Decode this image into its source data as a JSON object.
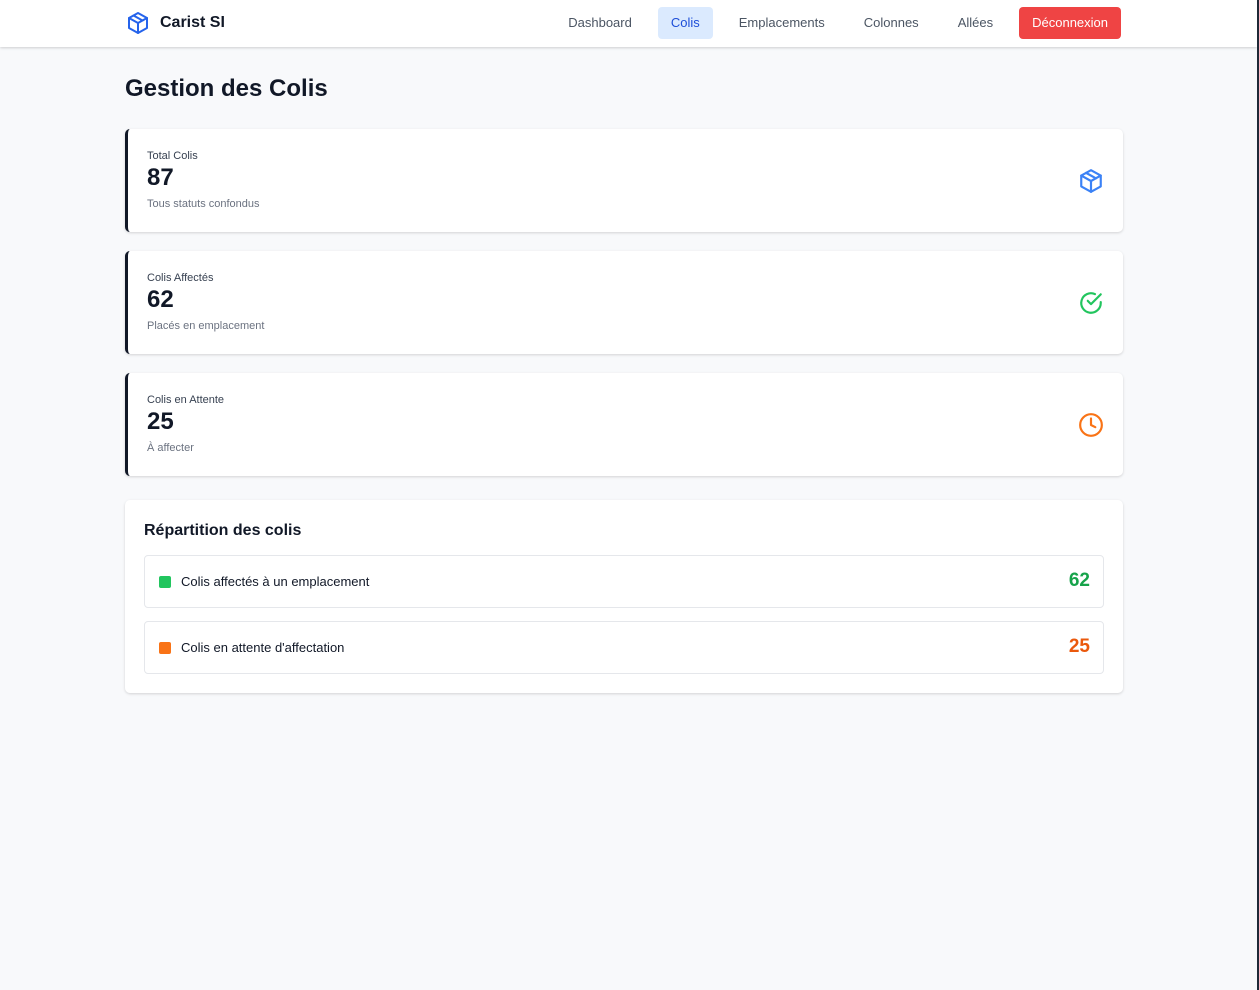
{
  "app": {
    "name": "Carist SI",
    "logo_icon": "package-icon"
  },
  "nav": {
    "items": [
      {
        "label": "Dashboard",
        "active": false
      },
      {
        "label": "Colis",
        "active": true
      },
      {
        "label": "Emplacements",
        "active": false
      },
      {
        "label": "Colonnes",
        "active": false
      },
      {
        "label": "Allées",
        "active": false
      }
    ],
    "logout_label": "Déconnexion"
  },
  "page": {
    "title": "Gestion des Colis"
  },
  "stats": [
    {
      "label": "Total Colis",
      "value": "87",
      "sub": "Tous statuts confondus",
      "icon": "package-icon",
      "color": "#3b82f6"
    },
    {
      "label": "Colis Affectés",
      "value": "62",
      "sub": "Placés en emplacement",
      "icon": "check-circle-icon",
      "color": "#22c55e"
    },
    {
      "label": "Colis en Attente",
      "value": "25",
      "sub": "À affecter",
      "icon": "clock-icon",
      "color": "#f97316"
    }
  ],
  "repartition": {
    "title": "Répartition des colis",
    "rows": [
      {
        "label": "Colis affectés à un emplacement",
        "value": "62",
        "color": "#22c55e",
        "value_color": "#16a34a"
      },
      {
        "label": "Colis en attente d'affectation",
        "value": "25",
        "color": "#f97316",
        "value_color": "#ea580c"
      }
    ]
  },
  "colors": {
    "primary": "#3b82f6",
    "danger": "#ef4444",
    "active_nav_bg": "#dbeafe"
  }
}
